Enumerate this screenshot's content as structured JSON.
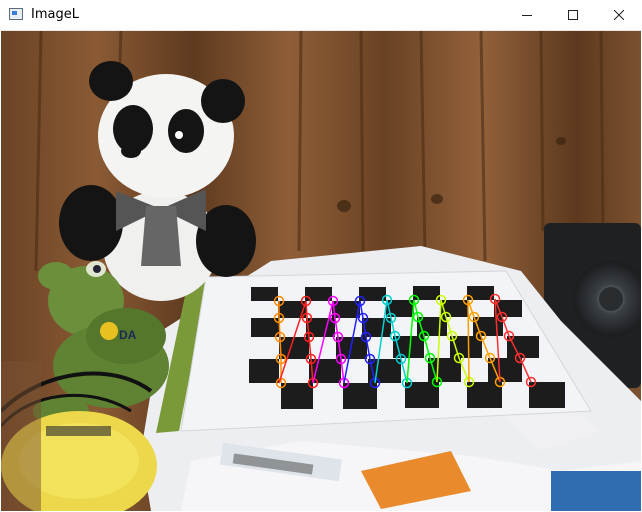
{
  "window": {
    "title": "ImageL",
    "icon": "app-window-icon",
    "controls": [
      "minimize-icon",
      "maximize-icon",
      "close-icon"
    ]
  },
  "image": {
    "description_icon": "camera-image",
    "checkerboard": {
      "pattern_cols": 10,
      "pattern_rows": 5,
      "corner_columns": 9,
      "corner_rows": 4,
      "column_colors": [
        "#ff8c00",
        "#ff2020",
        "#ff00ff",
        "#2020ff",
        "#00d0d0",
        "#00ff00",
        "#c8ff00",
        "#ffa000",
        "#ff3030"
      ]
    }
  }
}
